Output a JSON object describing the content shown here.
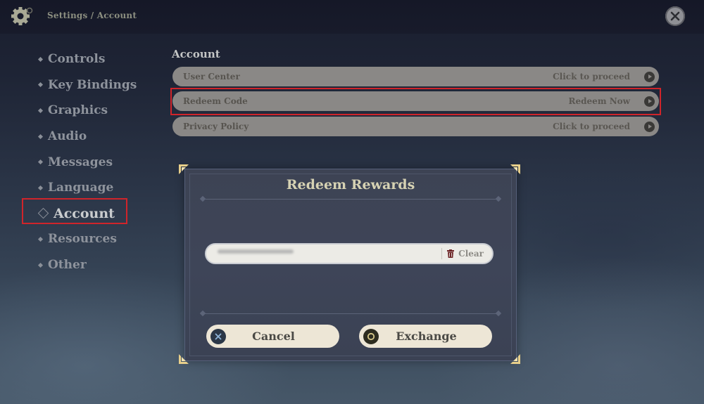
{
  "header": {
    "breadcrumb": "Settings / Account",
    "settings_icon": "gear-icon",
    "close_icon": "close-icon"
  },
  "sidebar": {
    "items": [
      {
        "label": "Controls",
        "active": false
      },
      {
        "label": "Key Bindings",
        "active": false
      },
      {
        "label": "Graphics",
        "active": false
      },
      {
        "label": "Audio",
        "active": false
      },
      {
        "label": "Messages",
        "active": false
      },
      {
        "label": "Language",
        "active": false
      },
      {
        "label": "Account",
        "active": true
      },
      {
        "label": "Resources",
        "active": false
      },
      {
        "label": "Other",
        "active": false
      }
    ]
  },
  "main": {
    "section_title": "Account",
    "rows": [
      {
        "label": "User Center",
        "action": "Click to proceed"
      },
      {
        "label": "Redeem Code",
        "action": "Redeem Now",
        "highlighted": true
      },
      {
        "label": "Privacy Policy",
        "action": "Click to proceed"
      }
    ]
  },
  "dialog": {
    "title": "Redeem Rewards",
    "code_input": {
      "value": "",
      "placeholder": "",
      "redacted": true
    },
    "clear_label": "Clear",
    "cancel_label": "Cancel",
    "exchange_label": "Exchange"
  },
  "colors": {
    "highlight_box": "#d0242a",
    "dialog_title": "#d6d2b3",
    "button_bg": "#ede6d6",
    "corner_gold": "#e8cf8a"
  }
}
